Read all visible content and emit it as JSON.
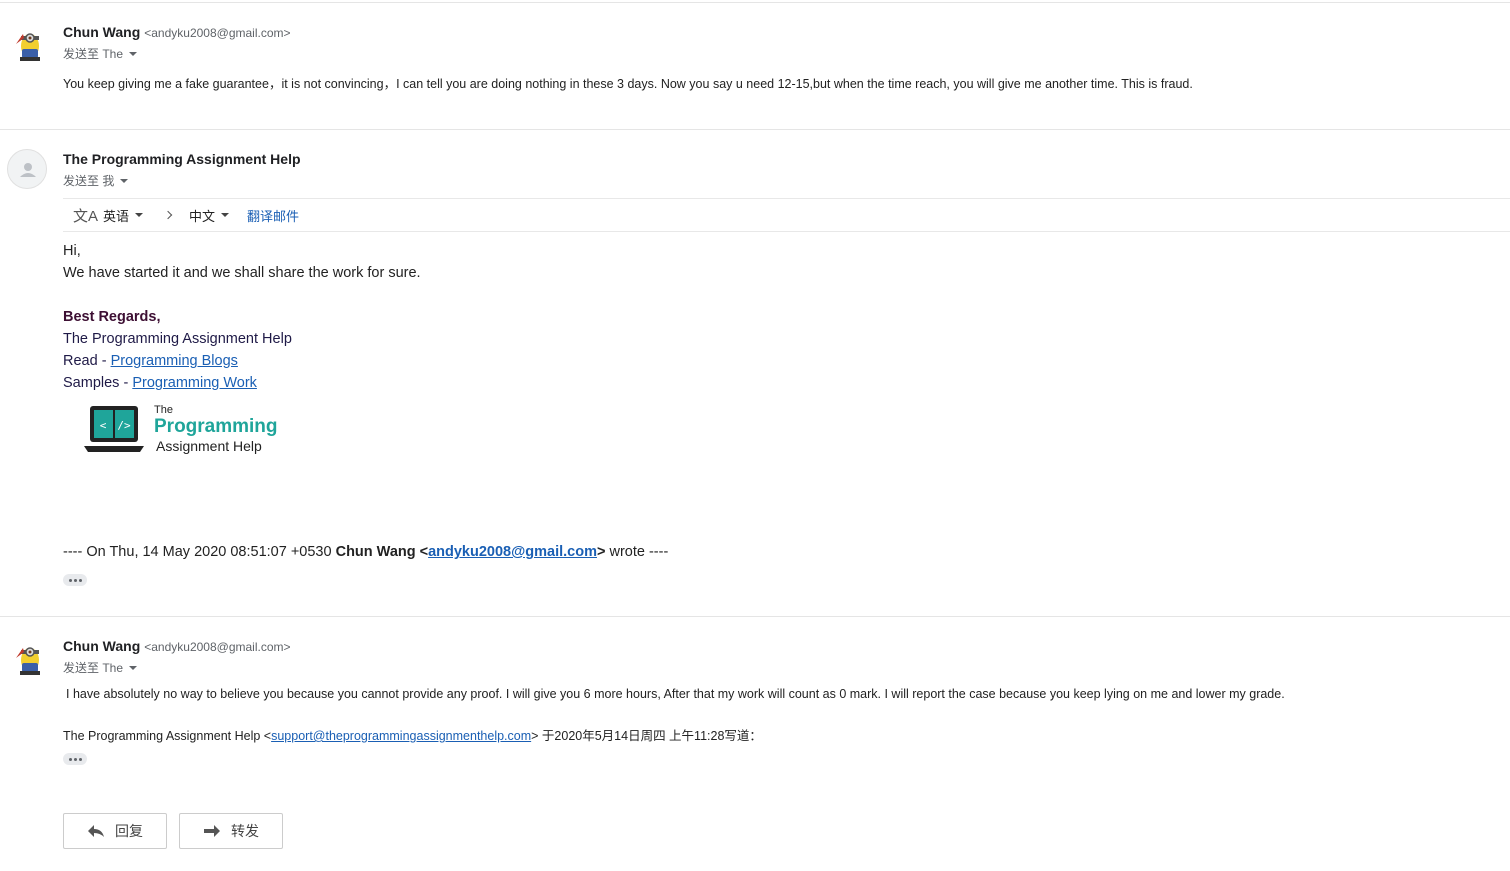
{
  "messages": [
    {
      "sender_name": "Chun Wang",
      "sender_email": "<andyku2008@gmail.com>",
      "to_line": "发送至 The",
      "body": "You keep giving me a fake guarantee，it is not convincing，I can tell you are doing nothing in these 3 days. Now you say u need 12-15,but when the time reach, you will give me another time. This is fraud."
    },
    {
      "sender_name": "The Programming Assignment Help",
      "to_line": "发送至 我",
      "translate": {
        "source_lang": "英语",
        "target_lang": "中文",
        "translate_label": "翻译邮件"
      },
      "greeting": "Hi,",
      "body": "We have started it and we shall share the work for sure.",
      "signature": {
        "regards": "Best Regards,",
        "company": "The Programming Assignment Help",
        "read_prefix": "Read - ",
        "read_link": "Programming Blogs",
        "samples_prefix": "Samples - ",
        "samples_link": "Programming Work",
        "logo_the": "The",
        "logo_programming": "Programming",
        "logo_assignment": "Assignment Help"
      },
      "quote": {
        "prefix": "---- On Thu, 14 May 2020 08:51:07 +0530 ",
        "name": "Chun Wang <",
        "email": "andyku2008@gmail.com",
        "suffix_bracket": ">",
        "suffix": " wrote ----"
      }
    },
    {
      "sender_name": "Chun Wang",
      "sender_email": "<andyku2008@gmail.com>",
      "to_line": "发送至 The",
      "body": " I have absolutely no way to believe you because you cannot provide any proof. I will give you 6 more hours, After that my work will count as 0 mark. I will report the case because you keep lying on me and lower my grade.",
      "quote": {
        "prefix": "The Programming Assignment Help <",
        "email": "support@theprogrammingassignmenthelp.com",
        "suffix": "> 于2020年5月14日周四 上午11:28写道："
      }
    }
  ],
  "actions": {
    "reply_label": "回复",
    "forward_label": "转发"
  },
  "colors": {
    "link": "#1a5fb4",
    "logo_teal": "#1fa59a"
  }
}
